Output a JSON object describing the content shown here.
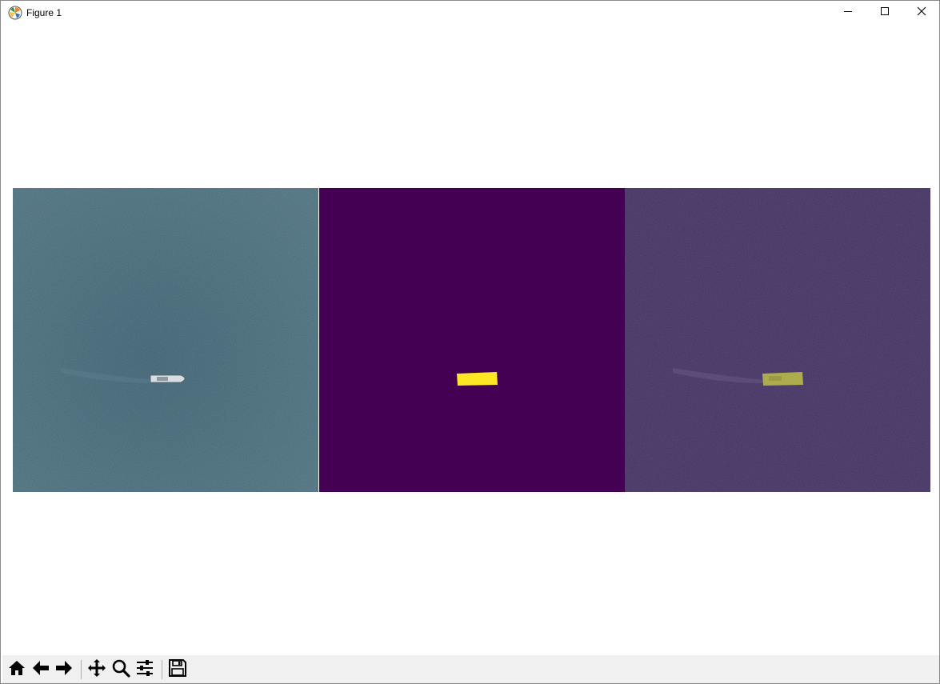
{
  "window": {
    "title": "Figure 1",
    "icons": {
      "app": "matplotlib-icon",
      "minimize": "minimize-icon",
      "maximize": "maximize-icon",
      "close": "close-icon"
    }
  },
  "figure": {
    "panels": [
      {
        "name": "satellite-image",
        "content": "ocean-with-ship"
      },
      {
        "name": "mask-image",
        "background": "#440154",
        "mask_color": "#fde725"
      },
      {
        "name": "overlay-image",
        "tint": "#44306a",
        "mask_color": "#c8c83c"
      }
    ]
  },
  "toolbar": {
    "buttons": [
      {
        "icon": "home-icon"
      },
      {
        "icon": "back-arrow-icon"
      },
      {
        "icon": "forward-arrow-icon"
      },
      {
        "icon": "pan-icon"
      },
      {
        "icon": "zoom-icon"
      },
      {
        "icon": "configure-subplots-icon"
      },
      {
        "icon": "save-icon"
      }
    ]
  },
  "colors": {
    "ocean": "#3f6373",
    "viridis_low": "#440154",
    "viridis_high": "#fde725",
    "toolbar_bg": "#f0f0f0"
  }
}
